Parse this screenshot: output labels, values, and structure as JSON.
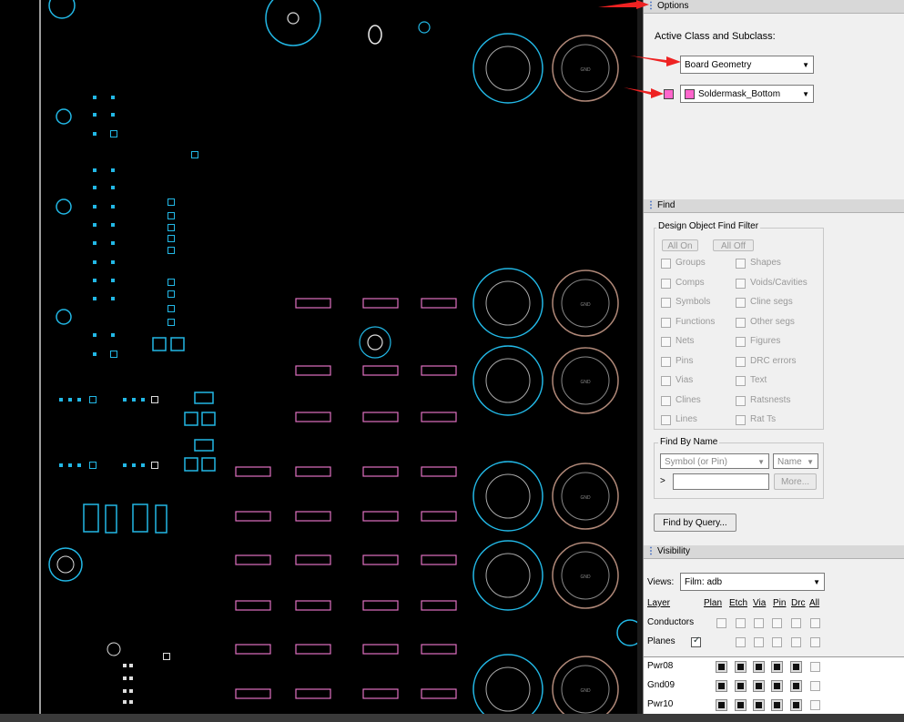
{
  "options": {
    "title": "Options",
    "active_label": "Active Class and Subclass:",
    "class_value": "Board Geometry",
    "subclass_value": "Soldermask_Bottom",
    "subclass_color": "#ff66cc"
  },
  "find": {
    "title": "Find",
    "filter_legend": "Design Object Find Filter",
    "all_on": "All On",
    "all_off": "All Off",
    "left_items": [
      "Groups",
      "Comps",
      "Symbols",
      "Functions",
      "Nets",
      "Pins",
      "Vias",
      "Clines",
      "Lines"
    ],
    "right_items": [
      "Shapes",
      "Voids/Cavities",
      "Cline segs",
      "Other segs",
      "Figures",
      "DRC errors",
      "Text",
      "Ratsnests",
      "Rat Ts"
    ],
    "by_name_legend": "Find By Name",
    "by_name_type": "Symbol (or Pin)",
    "by_name_mode": "Name",
    "prompt": ">",
    "more": "More...",
    "query_button": "Find by Query..."
  },
  "visibility": {
    "title": "Visibility",
    "views_label": "Views:",
    "views_value": "Film: adb",
    "layer_header": "Layer",
    "columns": [
      "Plan",
      "Etch",
      "Via",
      "Pin",
      "Drc",
      "All"
    ],
    "rows": [
      {
        "name": "Conductors",
        "plan_checked": false
      },
      {
        "name": "Planes",
        "plan_checked": true
      }
    ],
    "layers": [
      "Pwr08",
      "Gnd09",
      "Pwr10"
    ]
  },
  "canvas": {
    "pad_label_left": "GND",
    "pad_label_right": "GND",
    "colors": {
      "cyan": "#22b8e6",
      "pink": "#e070c0",
      "white": "#e8e8e8",
      "copper": "#b08878"
    }
  }
}
